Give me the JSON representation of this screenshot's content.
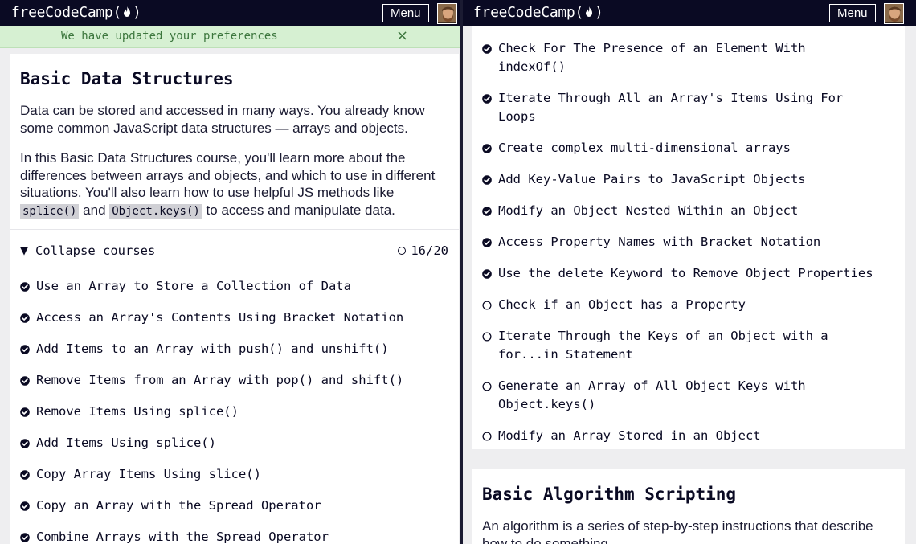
{
  "brand": {
    "logo_text": "freeCodeCamp",
    "logo_suffix": ""
  },
  "nav": {
    "menu_label": "Menu"
  },
  "flash": {
    "message": "We have updated your preferences",
    "close_symbol": "×"
  },
  "left": {
    "block_title": "Basic Data Structures",
    "intro_p1": "Data can be stored and accessed in many ways. You already know some common JavaScript data structures — arrays and objects.",
    "intro_p2_a": "In this Basic Data Structures course, you'll learn more about the differences between arrays and objects, and which to use in different situations. You'll also learn how to use helpful JS methods like ",
    "intro_p2_code1": "splice()",
    "intro_p2_b": " and ",
    "intro_p2_code2": "Object.keys()",
    "intro_p2_c": " to access and manipulate data.",
    "collapse_label": "Collapse courses",
    "collapse_icon": "triangle-down",
    "progress": "16/20",
    "challenges": [
      {
        "title": "Use an Array to Store a Collection of Data",
        "completed": true
      },
      {
        "title": "Access an Array's Contents Using Bracket Notation",
        "completed": true
      },
      {
        "title": "Add Items to an Array with push() and unshift()",
        "completed": true
      },
      {
        "title": "Remove Items from an Array with pop() and shift()",
        "completed": true
      },
      {
        "title": "Remove Items Using splice()",
        "completed": true
      },
      {
        "title": "Add Items Using splice()",
        "completed": true
      },
      {
        "title": "Copy Array Items Using slice()",
        "completed": true
      },
      {
        "title": "Copy an Array with the Spread Operator",
        "completed": true
      },
      {
        "title": "Combine Arrays with the Spread Operator",
        "completed": true
      }
    ]
  },
  "right": {
    "challenges": [
      {
        "line1": "Check For The Presence of an Element With",
        "line2": "indexOf()",
        "completed": true
      },
      {
        "line1": "Iterate Through All an Array's Items Using For",
        "line2": "Loops",
        "completed": true
      },
      {
        "line1": "Create complex multi-dimensional arrays",
        "line2": "",
        "completed": true
      },
      {
        "line1": "Add Key-Value Pairs to JavaScript Objects",
        "line2": "",
        "completed": true
      },
      {
        "line1": "Modify an Object Nested Within an Object",
        "line2": "",
        "completed": true
      },
      {
        "line1": "Access Property Names with Bracket Notation",
        "line2": "",
        "completed": true
      },
      {
        "line1": "Use the delete Keyword to Remove Object Properties",
        "line2": "",
        "completed": true
      },
      {
        "line1": "Check if an Object has a Property",
        "line2": "",
        "completed": false
      },
      {
        "line1": "Iterate Through the Keys of an Object with a",
        "line2": "for...in Statement",
        "completed": false
      },
      {
        "line1": "Generate an Array of All Object Keys with",
        "line2": "Object.keys()",
        "completed": false
      },
      {
        "line1": "Modify an Array Stored in an Object",
        "line2": "",
        "completed": false
      }
    ],
    "next_block_title": "Basic Algorithm Scripting",
    "next_block_intro": "An algorithm is a series of step-by-step instructions that describe how to do something."
  },
  "colors": {
    "nav_bg": "#0a0a23",
    "flash_bg": "#d6f0d2",
    "flash_text": "#3c763d",
    "text": "#0a0a23",
    "page_bg": "#eeeef0",
    "card_bg": "#ffffff"
  }
}
